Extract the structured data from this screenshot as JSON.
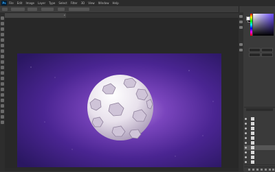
{
  "app": {
    "logo": "Ps",
    "menu": [
      "File",
      "Edit",
      "Image",
      "Layer",
      "Type",
      "Select",
      "Filter",
      "3D",
      "View",
      "Window",
      "Help"
    ]
  },
  "document": {
    "tab_label": "",
    "close_glyph": "×"
  },
  "colors": {
    "canvas_purple": "#5b2d9a",
    "canvas_dark": "#2a1a55",
    "ball": "#e9e4ec",
    "ui_dark": "#333333"
  },
  "right_panel": {
    "tabs": [
      "",
      ""
    ],
    "properties_label": "",
    "properties_title": "",
    "fields": [
      "",
      "",
      "",
      ""
    ]
  },
  "layers": {
    "tabs": [
      "",
      "",
      ""
    ],
    "filter_label": "",
    "rows": [
      "",
      "",
      "",
      "",
      "",
      "",
      "",
      "",
      "",
      ""
    ],
    "selected_index": 6
  }
}
